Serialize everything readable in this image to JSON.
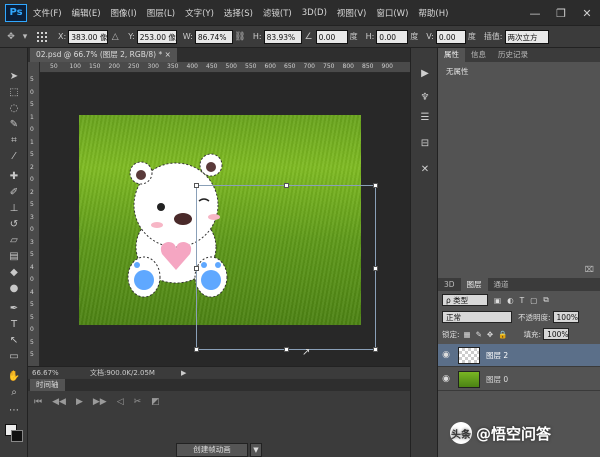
{
  "app": {
    "logo": "Ps"
  },
  "menu": [
    "文件(F)",
    "编辑(E)",
    "图像(I)",
    "图层(L)",
    "文字(Y)",
    "选择(S)",
    "滤镜(T)",
    "3D(D)",
    "视图(V)",
    "窗口(W)",
    "帮助(H)"
  ],
  "window_controls": {
    "minimize": "—",
    "restore": "❐",
    "close": "✕"
  },
  "options": {
    "x_label": "X:",
    "x_value": "383.00 像素",
    "y_label": "Y:",
    "y_value": "253.00 像素",
    "w_label": "W:",
    "w_value": "86.74%",
    "h_label": "H:",
    "h_value": "83.93%",
    "angle_value": "0.00",
    "angle_unit": "度",
    "h_skew_label": "H:",
    "h_skew_value": "0.00",
    "h_skew_unit": "度",
    "v_skew_label": "V:",
    "v_skew_value": "0.00",
    "v_skew_unit": "度",
    "interp_label": "插值:",
    "interp_value": "两次立方"
  },
  "document": {
    "tab_label": "02.psd @ 66.7% (图层 2, RGB/8) *",
    "tab_close": "×"
  },
  "ruler_top": [
    "50",
    "100",
    "150",
    "200",
    "250",
    "300",
    "350",
    "400",
    "450",
    "500",
    "550",
    "600",
    "650",
    "700",
    "750",
    "800",
    "850",
    "900"
  ],
  "ruler_left": [
    "5",
    "0",
    "5",
    "1",
    "0",
    "1",
    "5",
    "2",
    "0",
    "2",
    "5",
    "3",
    "0",
    "3",
    "5",
    "4",
    "0",
    "4",
    "5",
    "5",
    "0",
    "5",
    "5"
  ],
  "status": {
    "zoom": "66.67%",
    "doc_size": "文档:900.0K/2.05M",
    "arrow": "▶"
  },
  "timeline": {
    "tab_label": "时间轴",
    "create_button": "创建帧动画",
    "dropdown": "▼"
  },
  "properties": {
    "tabs": [
      "属性",
      "信息",
      "历史记录"
    ],
    "empty_text": "无属性"
  },
  "layers": {
    "tabs": [
      "3D",
      "图层",
      "通道"
    ],
    "filter_type": "ρ 类型",
    "blend_mode": "正常",
    "opacity_label": "不透明度:",
    "opacity_value": "100%",
    "lock_label": "锁定:",
    "fill_label": "填充:",
    "fill_value": "100%",
    "items": [
      {
        "name": "图层 2",
        "selected": true
      },
      {
        "name": "图层 0",
        "selected": false
      }
    ]
  },
  "watermark": {
    "logo": "头条",
    "text": "@悟空问答"
  },
  "colors": {
    "accent": "#31a8ff",
    "selected_layer": "#5b6f89",
    "grass": "#6aa51e"
  }
}
